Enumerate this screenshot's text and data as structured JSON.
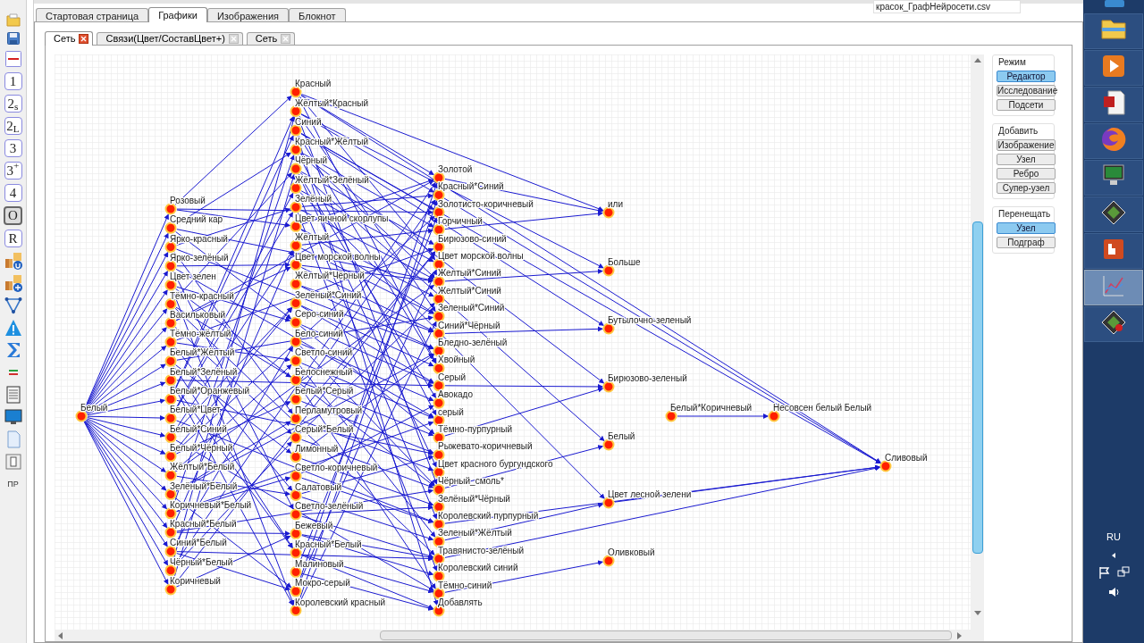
{
  "main_tabs": [
    {
      "label": "Стартовая страница",
      "selected": false
    },
    {
      "label": "Графики",
      "selected": true
    },
    {
      "label": "Изображения",
      "selected": false
    },
    {
      "label": "Блокнот",
      "selected": false
    }
  ],
  "file_field": {
    "value": "красок_ГрафНейросети.csv"
  },
  "sub_tabs": [
    {
      "label": "Сеть",
      "selected": true
    },
    {
      "label": "Связи(Цвет/СоставЦвет+)",
      "selected": false
    },
    {
      "label": "Сеть",
      "selected": false
    }
  ],
  "tools": [
    {
      "label": "1",
      "selected": false
    },
    {
      "label": "2$_{s}$",
      "selected": false
    },
    {
      "label": "2$_{L}$",
      "selected": false
    },
    {
      "label": "3",
      "selected": false
    },
    {
      "label": "3$^{+}$",
      "selected": false
    },
    {
      "label": "4",
      "selected": false
    },
    {
      "label": "O",
      "selected": true
    },
    {
      "label": "R",
      "selected": false
    }
  ],
  "tool_caption": "ПР",
  "graph": {
    "columns": [
      {
        "nodes": [
          {
            "label": "Белый"
          }
        ]
      },
      {
        "nodes": [
          {
            "label": "Розовый"
          },
          {
            "label": "Средний кар"
          },
          {
            "label": "Ярко-красный"
          },
          {
            "label": "Ярко-зелёный"
          },
          {
            "label": "Цвет зелен"
          },
          {
            "label": "Тёмно-красный"
          },
          {
            "label": "Васильковый"
          },
          {
            "label": "Тёмно-жёлтый"
          },
          {
            "label": "Белый*Жёлтый"
          },
          {
            "label": "Белый*Зелёный"
          },
          {
            "label": "Белый*Оранжевый"
          },
          {
            "label": "Белый*Цвет"
          },
          {
            "label": "Белый*Синий"
          },
          {
            "label": "Белый*Чёрный"
          },
          {
            "label": "Жёлтый*Белый"
          },
          {
            "label": "Зелёный*Белый"
          },
          {
            "label": "Коричневый*Белый"
          },
          {
            "label": "Красный*Белый"
          },
          {
            "label": "Синий*Белый"
          },
          {
            "label": "Чёрный*Белый"
          },
          {
            "label": "Коричневый"
          }
        ]
      },
      {
        "nodes": [
          {
            "label": "Красный"
          },
          {
            "label": "Жёлтый*Красный"
          },
          {
            "label": "Синий"
          },
          {
            "label": "Красный*Жёлтый"
          },
          {
            "label": "Чёрный"
          },
          {
            "label": "Жёлтый*Зелёный"
          },
          {
            "label": "Зелёный"
          },
          {
            "label": "Цвет яичной скорлупы"
          },
          {
            "label": "Жёлтый"
          },
          {
            "label": "Цвет морской волны"
          },
          {
            "label": "Жёлтый*Чёрный"
          },
          {
            "label": "Зелёный*Синий"
          },
          {
            "label": "Серо-синий"
          },
          {
            "label": "Бело-синий"
          },
          {
            "label": "Светло-синий"
          },
          {
            "label": "Белоснежный"
          },
          {
            "label": "Белый*Серый"
          },
          {
            "label": "Перламутровый"
          },
          {
            "label": "Серый*Белый"
          },
          {
            "label": "Лимонный"
          },
          {
            "label": "Светло-коричневый"
          },
          {
            "label": "Салатовый"
          },
          {
            "label": "Светло-зелёный"
          },
          {
            "label": "Бежевый"
          },
          {
            "label": "Красный*Белый"
          },
          {
            "label": "Малиновый"
          },
          {
            "label": "Мокро-серый"
          },
          {
            "label": "Королевский красный"
          }
        ]
      },
      {
        "nodes": [
          {
            "label": "Золотой"
          },
          {
            "label": "Красный*Синий"
          },
          {
            "label": "Золотисто-коричневый"
          },
          {
            "label": "Горчичный"
          },
          {
            "label": "Бирюзово-синий"
          },
          {
            "label": "Цвет морской волны"
          },
          {
            "label": "Желтый*Синий"
          },
          {
            "label": "Желтый*Синий"
          },
          {
            "label": "Зеленый*Синий"
          },
          {
            "label": "Синий*Чёрный"
          },
          {
            "label": "Бледно-зелёный"
          },
          {
            "label": "Хвойный"
          },
          {
            "label": "Серый"
          },
          {
            "label": "Авокадо"
          },
          {
            "label": "серый"
          },
          {
            "label": "Тёмно-пурпурный"
          },
          {
            "label": "Рыжевато-коричневый"
          },
          {
            "label": "Цвет красного бургундского"
          },
          {
            "label": "Чёрный_смоль*"
          },
          {
            "label": "Зелёный*Чёрный"
          },
          {
            "label": "Королевский пурпурный"
          },
          {
            "label": "Зеленый*Жёлтый"
          },
          {
            "label": "Травянисто-зелёный"
          },
          {
            "label": "Королевский синий"
          },
          {
            "label": "Тёмно-синий"
          },
          {
            "label": "Добавлять"
          }
        ]
      },
      {
        "nodes": [
          {
            "label": "или"
          },
          {
            "label": "Больше"
          },
          {
            "label": "Бутылочно-зеленый"
          },
          {
            "label": "Бирюзово-зеленый"
          },
          {
            "label": "Белый"
          },
          {
            "label": "Цвет лесной зелени"
          },
          {
            "label": "Оливковый"
          }
        ]
      }
    ],
    "pair": [
      {
        "label": "Белый*Коричневый"
      },
      {
        "label": "Несовсен белый Белый"
      }
    ],
    "sink": {
      "label": "Сливовый"
    }
  },
  "panel": [
    {
      "title": "Режим",
      "buttons": [
        {
          "label": "Редактор",
          "selected": true
        },
        {
          "label": "Исследование",
          "selected": false
        },
        {
          "label": "Подсети",
          "selected": false
        }
      ]
    },
    {
      "title": "Добавить",
      "buttons": [
        {
          "label": "Изображение",
          "selected": false
        },
        {
          "label": "Узел",
          "selected": false
        },
        {
          "label": "Ребро",
          "selected": false
        },
        {
          "label": "Супер-узел",
          "selected": false
        }
      ]
    },
    {
      "title": "Перенещать",
      "buttons": [
        {
          "label": "Узел",
          "selected": true
        },
        {
          "label": "Подграф",
          "selected": false
        }
      ]
    }
  ],
  "tray": {
    "language": "RU"
  }
}
